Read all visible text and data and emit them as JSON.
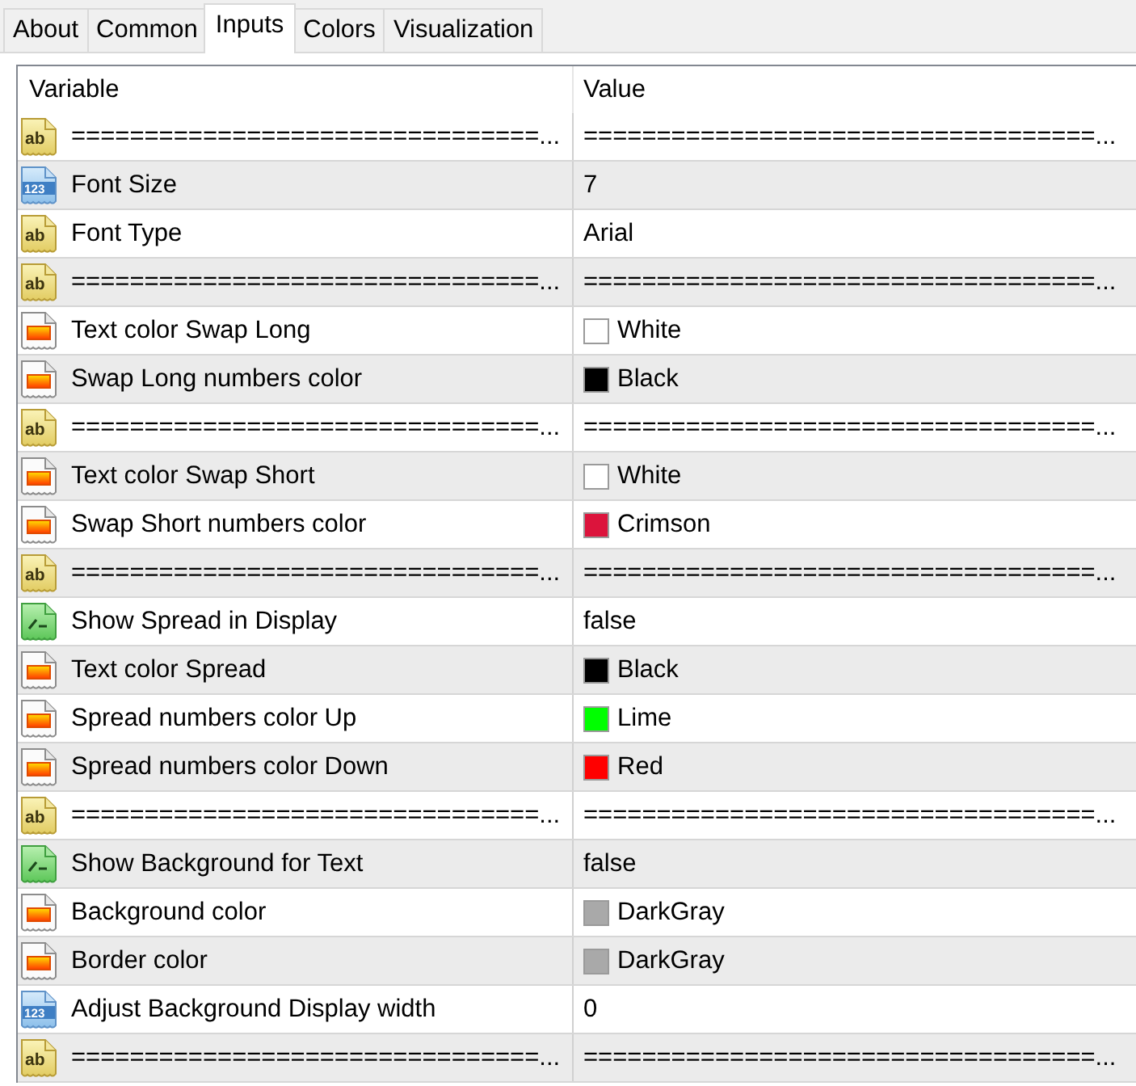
{
  "tabs": [
    {
      "label": "About",
      "selected": false
    },
    {
      "label": "Common",
      "selected": false
    },
    {
      "label": "Inputs",
      "selected": true
    },
    {
      "label": "Colors",
      "selected": false
    },
    {
      "label": "Visualization",
      "selected": false
    }
  ],
  "table": {
    "columns": [
      "Variable",
      "Value"
    ],
    "rows": [
      {
        "kind": "string",
        "icon_text": "ab",
        "variable": "================================...",
        "value": "===================================..."
      },
      {
        "kind": "int",
        "icon_text": "123",
        "variable": "Font Size",
        "value": "7"
      },
      {
        "kind": "string",
        "icon_text": "ab",
        "variable": "Font Type",
        "value": "Arial"
      },
      {
        "kind": "string",
        "icon_text": "ab",
        "variable": "================================...",
        "value": "===================================..."
      },
      {
        "kind": "color",
        "variable": "Text color Swap Long",
        "value": "White",
        "color": "#ffffff"
      },
      {
        "kind": "color",
        "variable": "Swap Long numbers color",
        "value": "Black",
        "color": "#000000"
      },
      {
        "kind": "string",
        "icon_text": "ab",
        "variable": "================================...",
        "value": "===================================..."
      },
      {
        "kind": "color",
        "variable": "Text color Swap Short",
        "value": "White",
        "color": "#ffffff"
      },
      {
        "kind": "color",
        "variable": "Swap Short numbers color",
        "value": "Crimson",
        "color": "#dc143c"
      },
      {
        "kind": "string",
        "icon_text": "ab",
        "variable": "================================...",
        "value": "===================================..."
      },
      {
        "kind": "bool",
        "variable": "Show Spread in Display",
        "value": "false"
      },
      {
        "kind": "color",
        "variable": "Text color Spread",
        "value": "Black",
        "color": "#000000"
      },
      {
        "kind": "color",
        "variable": "Spread numbers color Up",
        "value": "Lime",
        "color": "#00ff00"
      },
      {
        "kind": "color",
        "variable": "Spread numbers color Down",
        "value": "Red",
        "color": "#ff0000"
      },
      {
        "kind": "string",
        "icon_text": "ab",
        "variable": "================================...",
        "value": "===================================..."
      },
      {
        "kind": "bool",
        "variable": "Show Background for Text",
        "value": "false"
      },
      {
        "kind": "color",
        "variable": "Background color",
        "value": "DarkGray",
        "color": "#a9a9a9"
      },
      {
        "kind": "color",
        "variable": "Border color",
        "value": "DarkGray",
        "color": "#a9a9a9"
      },
      {
        "kind": "int",
        "icon_text": "123",
        "variable": "Adjust Background Display width",
        "value": "0"
      },
      {
        "kind": "string",
        "icon_text": "ab",
        "variable": "================================...",
        "value": "===================================..."
      }
    ]
  }
}
